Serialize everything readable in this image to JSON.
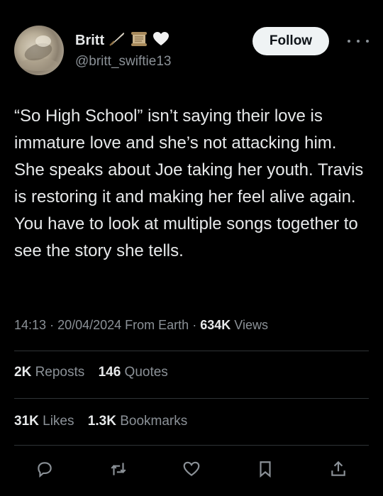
{
  "user": {
    "name": "Britt",
    "handle": "@britt_swiftie13",
    "badges": [
      "quill-icon",
      "scroll-icon",
      "white-heart-icon"
    ]
  },
  "follow_label": "Follow",
  "tweet": {
    "text": "“So High School” isn’t saying their love is immature love and she’s not attacking him. She speaks about Joe taking her youth. Travis is restoring it and making her feel alive again. You have to look at multiple songs together to see the story she tells."
  },
  "meta": {
    "time": "14:13",
    "date": "20/04/2024",
    "location": "From Earth",
    "views_count": "634K",
    "views_label": "Views"
  },
  "stats": {
    "reposts_count": "2K",
    "reposts_label": "Reposts",
    "quotes_count": "146",
    "quotes_label": "Quotes",
    "likes_count": "31K",
    "likes_label": "Likes",
    "bookmarks_count": "1.3K",
    "bookmarks_label": "Bookmarks"
  },
  "actions": [
    "reply-icon",
    "repost-icon",
    "like-icon",
    "bookmark-icon",
    "share-icon"
  ],
  "colors": {
    "background": "#000000",
    "text": "#e7e9ea",
    "muted": "#8b9197",
    "follow_bg": "#eff3f4"
  }
}
